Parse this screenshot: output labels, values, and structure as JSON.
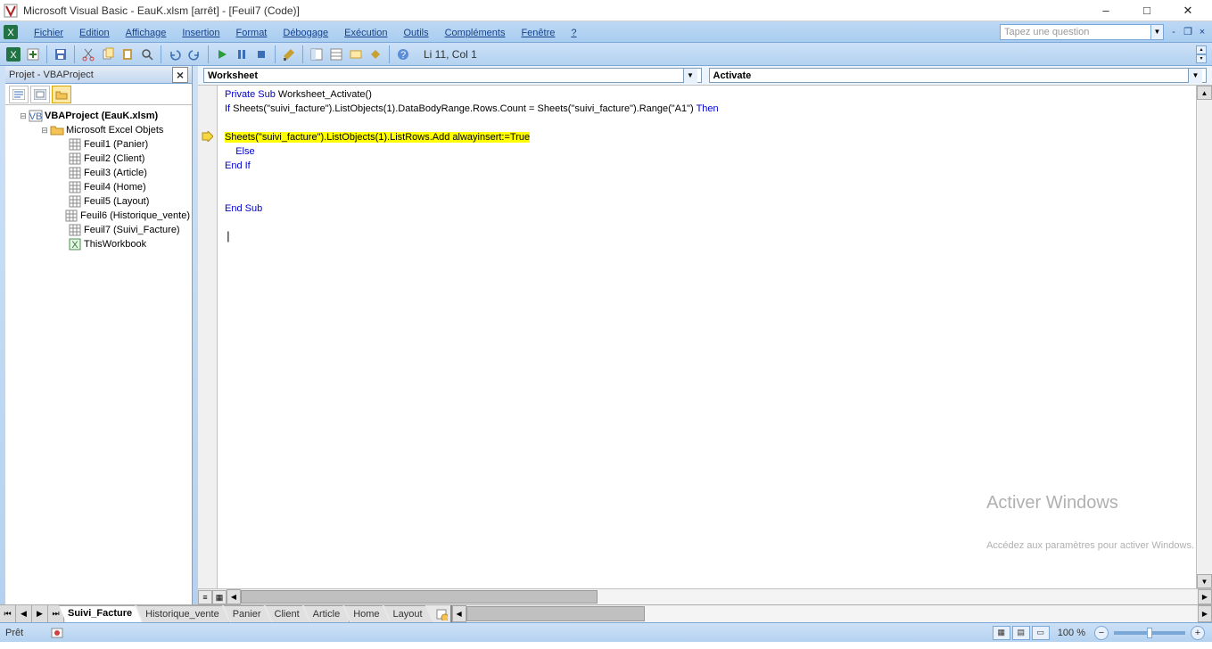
{
  "title": "Microsoft Visual Basic - EauK.xlsm [arrêt] - [Feuil7 (Code)]",
  "menu": {
    "items": [
      "Fichier",
      "Edition",
      "Affichage",
      "Insertion",
      "Format",
      "Débogage",
      "Exécution",
      "Outils",
      "Compléments",
      "Fenêtre",
      "?"
    ],
    "question_placeholder": "Tapez une question"
  },
  "toolbar": {
    "status": "Li 11, Col 1"
  },
  "project_panel": {
    "title": "Projet - VBAProject",
    "root": "VBAProject (EauK.xlsm)",
    "folder": "Microsoft Excel Objets",
    "items": [
      "Feuil1 (Panier)",
      "Feuil2 (Client)",
      "Feuil3 (Article)",
      "Feuil4 (Home)",
      "Feuil5 (Layout)",
      "Feuil6 (Historique_vente)",
      "Feuil7 (Suivi_Facture)",
      "ThisWorkbook"
    ]
  },
  "code_dropdowns": {
    "object": "Worksheet",
    "procedure": "Activate"
  },
  "code": {
    "line1_a": "Private Sub",
    "line1_b": " Worksheet_Activate()",
    "line2_a": "If",
    "line2_b": " Sheets(\"suivi_facture\").ListObjects(1).DataBodyRange.Rows.Count = Sheets(\"suivi_facture\").Range(\"A1\") ",
    "line2_c": "Then",
    "line4_hl": "Sheets(\"suivi_facture\").ListObjects(1).ListRows.Add alwayinsert:=True",
    "line5": "    Else",
    "line6": "End If",
    "line9": "End Sub"
  },
  "sheet_tabs": {
    "active": "Suivi_Facture",
    "tabs": [
      "Suivi_Facture",
      "Historique_vente",
      "Panier",
      "Client",
      "Article",
      "Home",
      "Layout"
    ]
  },
  "statusbar": {
    "ready": "Prêt",
    "zoom": "100 %"
  },
  "watermark": {
    "l1": "Activer Windows",
    "l2": "Accédez aux paramètres pour activer Windows."
  }
}
